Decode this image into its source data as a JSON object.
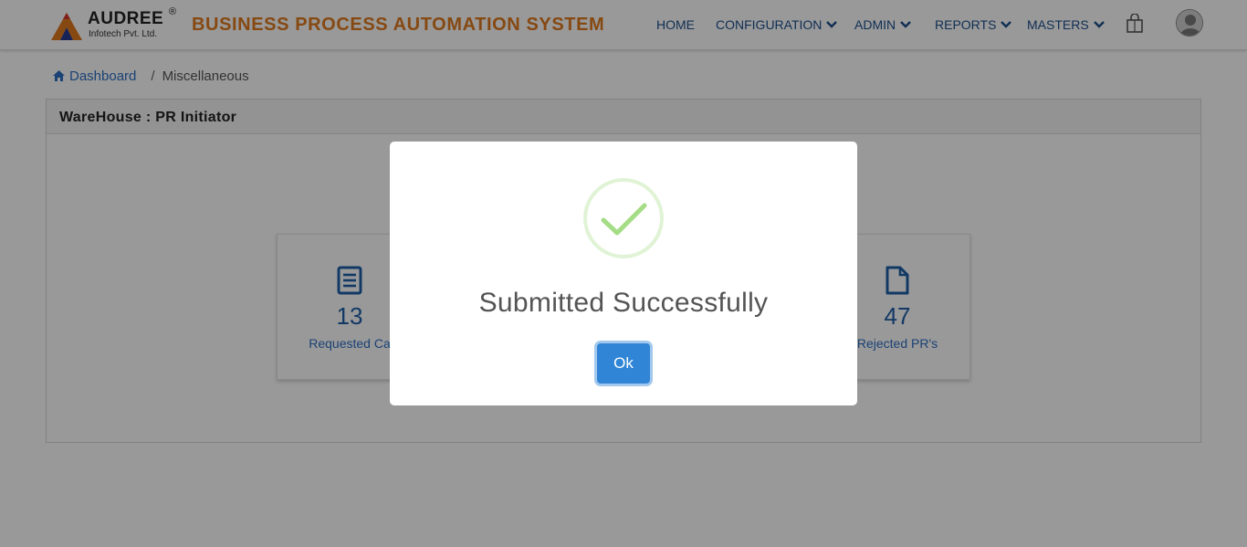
{
  "brand": {
    "logo_name": "AUDREE",
    "logo_registered": "®",
    "logo_tagline": "Infotech Pvt. Ltd.",
    "app_title": "BUSINESS PROCESS AUTOMATION SYSTEM",
    "title_color": "#e07a1f"
  },
  "nav": {
    "items": [
      {
        "label": "HOME",
        "dropdown": false
      },
      {
        "label": "CONFIGURATION",
        "dropdown": true
      },
      {
        "label": "ADMIN",
        "dropdown": true
      },
      {
        "label": "REPORTS",
        "dropdown": true
      },
      {
        "label": "MASTERS",
        "dropdown": true
      }
    ],
    "icons": [
      "shopping-bag-icon",
      "user-avatar-icon"
    ]
  },
  "breadcrumb": {
    "home_label": "Dashboard",
    "separator": "/",
    "current": "Miscellaneous"
  },
  "panel": {
    "title": "WareHouse : PR Initiator"
  },
  "cards": [
    {
      "count": "13",
      "label": "Requested Ca",
      "icon": "document-list-icon"
    },
    {
      "count": "47",
      "label": "Rejected PR's",
      "icon": "file-icon"
    }
  ],
  "modal": {
    "title": "Submitted Successfully",
    "ok_label": "Ok",
    "icon": "success-check-icon",
    "accent_color": "#3085d6",
    "check_color": "#a5dc86"
  }
}
